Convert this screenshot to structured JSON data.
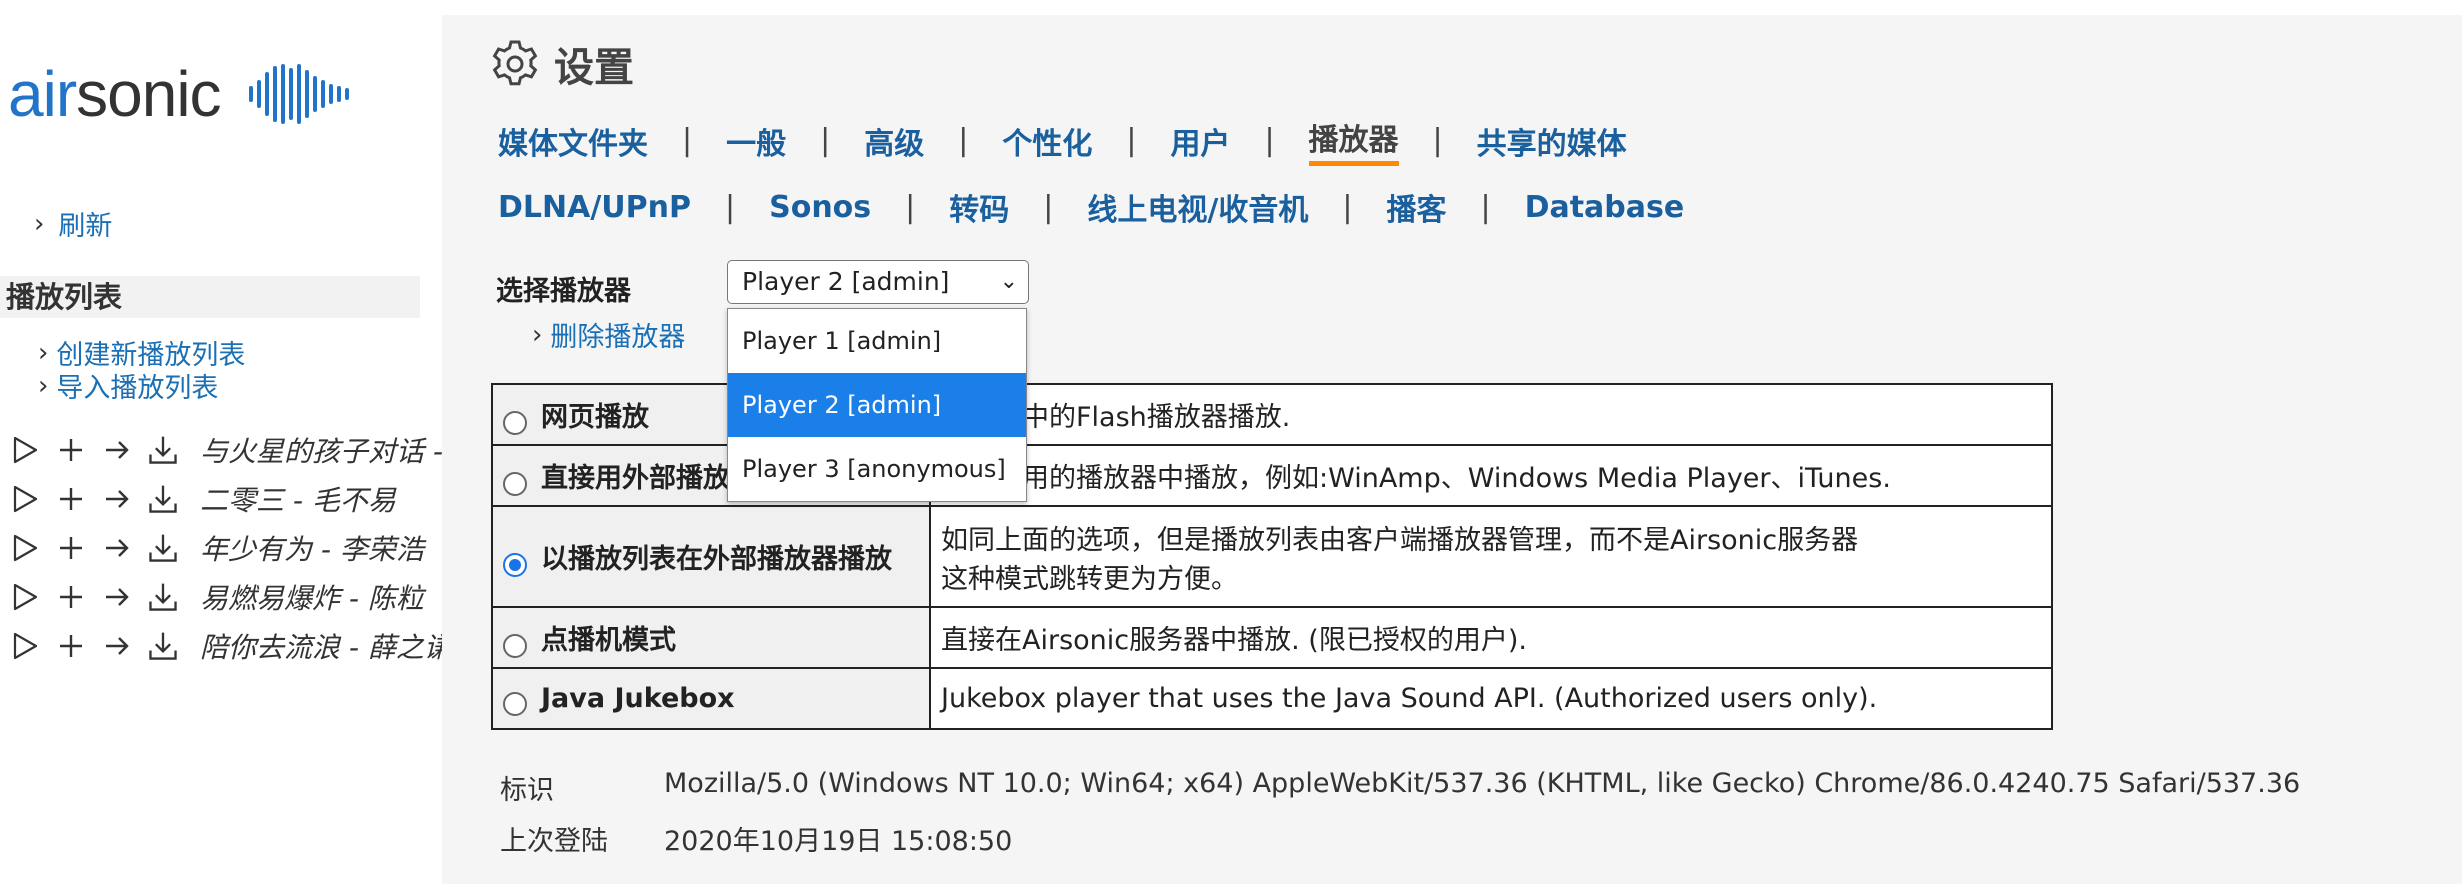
{
  "brand": {
    "air": "air",
    "sonic": "sonic"
  },
  "left": {
    "refresh": "刷新",
    "playlists_heading": "播放列表",
    "create_playlist": "创建新播放列表",
    "import_playlist": "导入播放列表",
    "songs": [
      "与火星的孩子对话 -",
      "二零三 - 毛不易",
      "年少有为 - 李荣浩",
      "易燃易爆炸 - 陈粒",
      "陪你去流浪 - 薛之谦"
    ]
  },
  "main": {
    "title": "设置",
    "tabs_row1": [
      "媒体文件夹",
      "一般",
      "高级",
      "个性化",
      "用户",
      "播放器",
      "共享的媒体"
    ],
    "active_tab": "播放器",
    "tabs_row2": [
      "DLNA/UPnP",
      "Sonos",
      "转码",
      "线上电视/收音机",
      "播客",
      "Database"
    ],
    "select_player_label": "选择播放器",
    "selected_player": "Player 2 [admin]",
    "delete_player": "删除播放器",
    "player_options": [
      "Player 1 [admin]",
      "Player 2 [admin]",
      "Player 3 [anonymous]"
    ],
    "modes": [
      {
        "name": "网页播放",
        "desc": "在网页中的Flash播放器播放.",
        "selected": false
      },
      {
        "name": "直接用外部播放器播放",
        "desc": "在你常用的播放器中播放，例如:WinAmp、Windows Media Player、iTunes.",
        "selected": false
      },
      {
        "name": "以播放列表在外部播放器播放",
        "desc": "如同上面的选项，但是播放列表由客户端播放器管理，而不是Airsonic服务器",
        "desc2": "这种模式跳转更为方便。",
        "selected": true
      },
      {
        "name": "点播机模式",
        "desc": "直接在Airsonic服务器中播放. (限已授权的用户).",
        "selected": false
      },
      {
        "name": "Java Jukebox",
        "desc": "Jukebox player that uses the Java Sound API. (Authorized users only).",
        "selected": false
      }
    ],
    "info": {
      "id_label": "标识",
      "id_value": "Mozilla/5.0 (Windows NT 10.0; Win64; x64) AppleWebKit/537.36 (KHTML, like Gecko) Chrome/86.0.4240.75 Safari/537.36",
      "last_login_label": "上次登陆",
      "last_login_value": "2020年10月19日 15:08:50"
    }
  },
  "colors": {
    "link": "#1a6fb5",
    "tab": "#1a5f9e",
    "active_underline": "#ff8a00",
    "highlight": "#1a7fe8",
    "brand_blue": "#2174c8"
  }
}
